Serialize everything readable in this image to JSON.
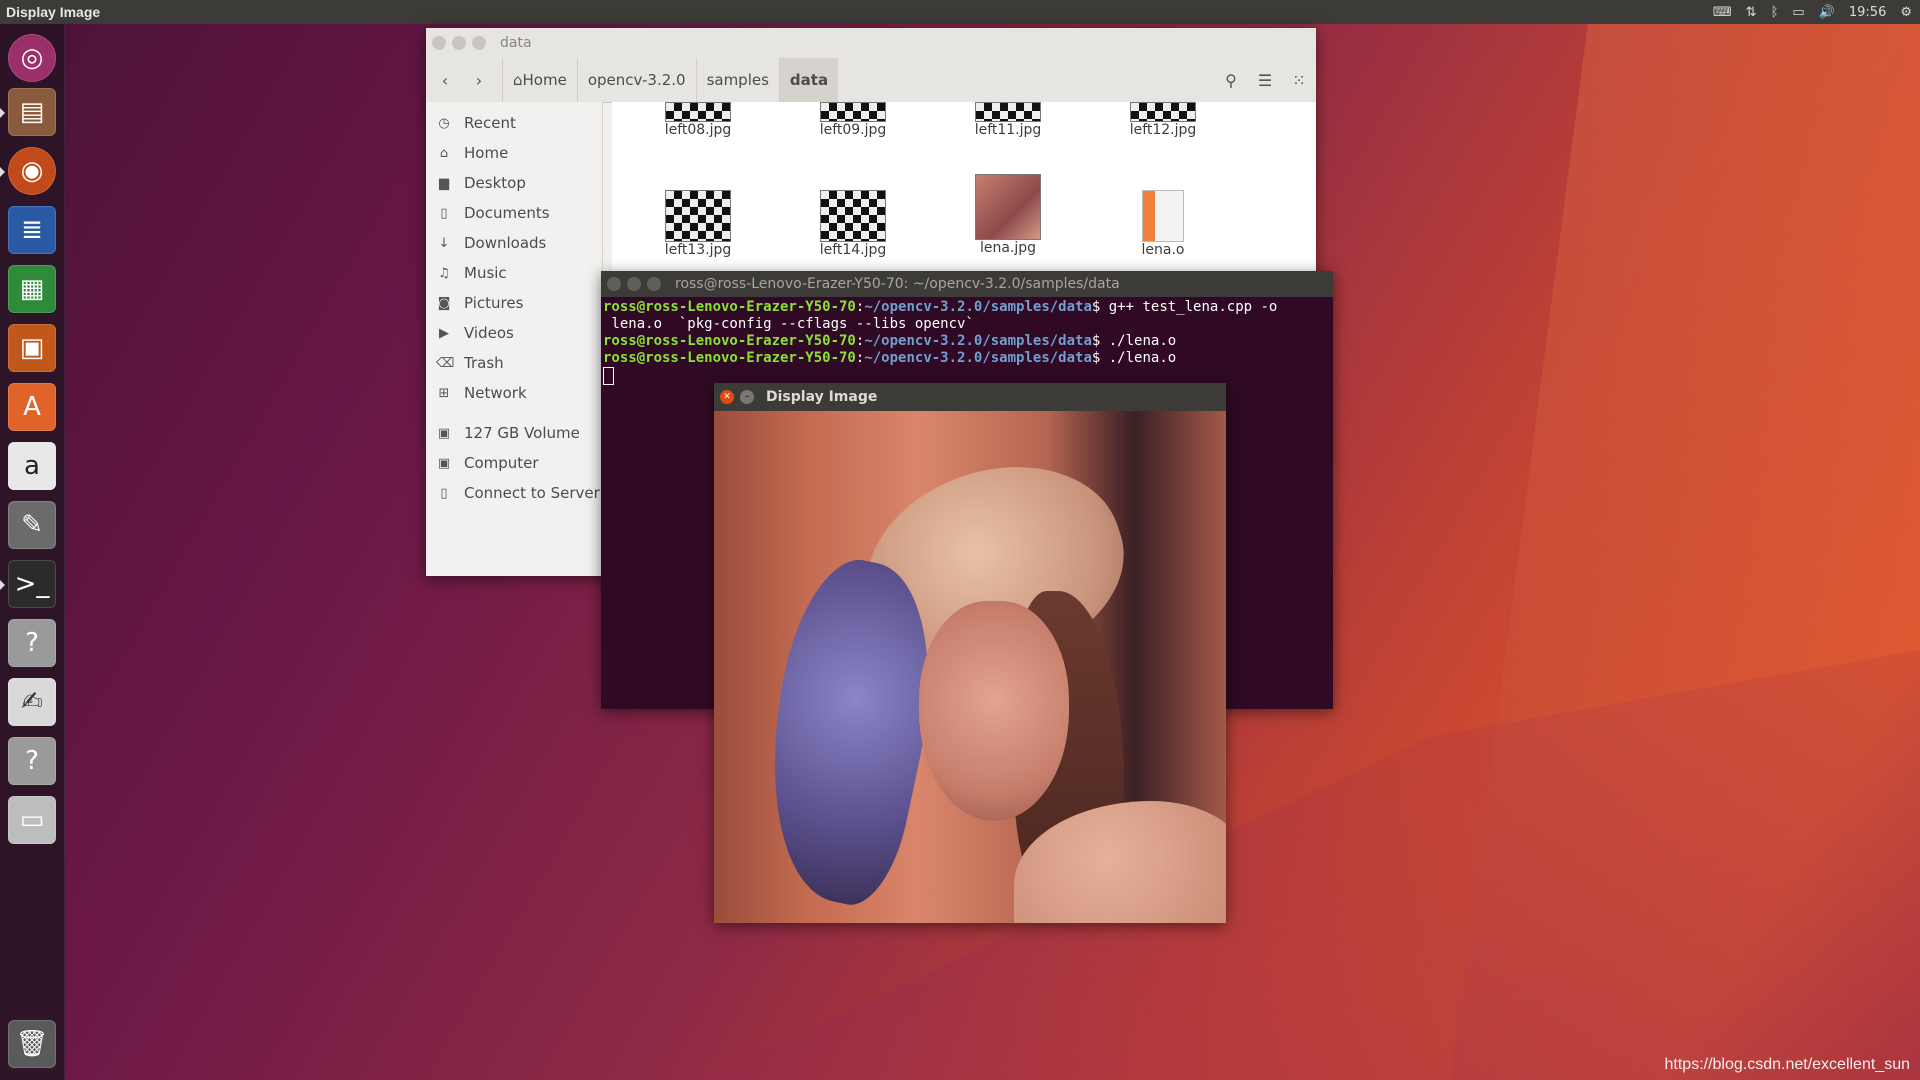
{
  "top_panel": {
    "title": "Display Image",
    "time": "19:56"
  },
  "launcher": {
    "items": [
      "ubuntu-dash-icon",
      "files-icon",
      "firefox-icon",
      "writer-icon",
      "calc-icon",
      "impress-icon",
      "software-center-icon",
      "amazon-icon",
      "system-settings-icon",
      "terminal-icon",
      "unknown-app-icon",
      "text-editor-icon",
      "unknown-app-icon",
      "disk-icon",
      "trash-icon"
    ]
  },
  "file_manager": {
    "title": "data",
    "breadcrumbs": [
      "Home",
      "opencv-3.2.0",
      "samples",
      "data"
    ],
    "sidebar": [
      "Recent",
      "Home",
      "Desktop",
      "Documents",
      "Downloads",
      "Music",
      "Pictures",
      "Videos",
      "Trash",
      "Network"
    ],
    "devices": [
      "127 GB Volume",
      "Computer",
      "Connect to Server"
    ],
    "files_row1": [
      "left08.jpg",
      "left09.jpg",
      "left11.jpg",
      "left12.jpg"
    ],
    "files_row2": [
      "left13.jpg",
      "left14.jpg",
      "lena.jpg",
      "lena.o"
    ]
  },
  "terminal": {
    "title": "ross@ross-Lenovo-Erazer-Y50-70: ~/opencv-3.2.0/samples/data",
    "user_host": "ross@ross-Lenovo-Erazer-Y50-70",
    "path": "~/opencv-3.2.0/samples/data",
    "lines": [
      {
        "cmd": " g++ test_lena.cpp -o",
        "cont": " lena.o  `pkg-config --cflags --libs opencv`"
      },
      {
        "cmd": " ./lena.o"
      },
      {
        "cmd": " ./lena.o"
      }
    ]
  },
  "display_window": {
    "title": "Display Image"
  },
  "watermark": "https://blog.csdn.net/excellent_sun"
}
